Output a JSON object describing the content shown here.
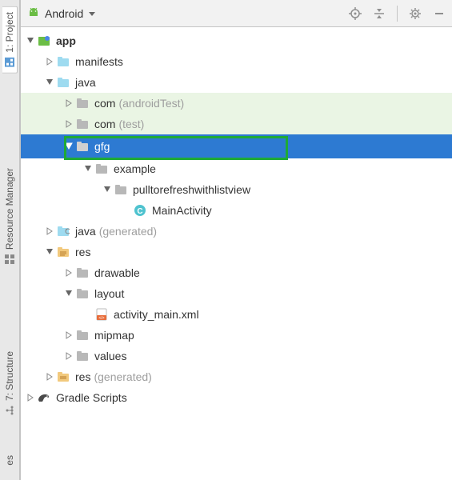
{
  "left_tabs": {
    "project": "1: Project",
    "resource_manager": "Resource Manager",
    "structure": "7: Structure",
    "favorites_trunc": "es"
  },
  "toolbar": {
    "view_label": "Android"
  },
  "tree": {
    "app": "app",
    "manifests": "manifests",
    "java": "java",
    "com1": "com",
    "com1_sub": "(androidTest)",
    "com2": "com",
    "com2_sub": "(test)",
    "gfg": "gfg",
    "example": "example",
    "pulltorefresh": "pulltorefreshwithlistview",
    "mainactivity": "MainActivity",
    "java_gen": "java",
    "java_gen_sub": "(generated)",
    "res": "res",
    "drawable": "drawable",
    "layout": "layout",
    "activity_main": "activity_main.xml",
    "mipmap": "mipmap",
    "values": "values",
    "res_gen": "res",
    "res_gen_sub": "(generated)",
    "gradle": "Gradle Scripts"
  }
}
